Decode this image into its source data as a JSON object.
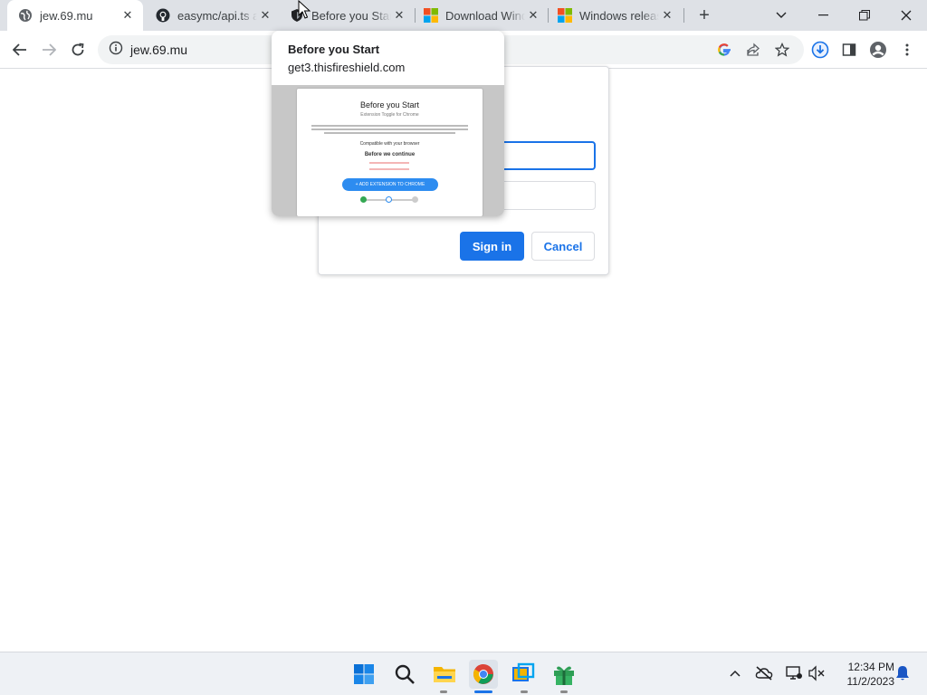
{
  "tabs": [
    {
      "title": "jew.69.mu",
      "favicon": "globe-icon",
      "active": true
    },
    {
      "title": "easymc/api.ts at",
      "favicon": "github-icon",
      "active": false
    },
    {
      "title": "Before you Start",
      "favicon": "shield-icon",
      "active": false
    },
    {
      "title": "Download Wind",
      "favicon": "microsoft-logo-icon",
      "active": false
    },
    {
      "title": "Windows releas",
      "favicon": "microsoft-logo-icon",
      "active": false
    }
  ],
  "address_bar": {
    "url": "jew.69.mu"
  },
  "auth_dialog": {
    "sign_in_label": "Sign in",
    "cancel_label": "Cancel"
  },
  "hover_card": {
    "title": "Before you Start",
    "domain": "get3.thisfireshield.com",
    "preview": {
      "heading": "Before you Start",
      "subheading": "Extension Toggle for Chrome",
      "compat_text": "Compatible with your browser",
      "continue_heading": "Before we continue",
      "cta_label": "+ ADD EXTENSION TO CHROME"
    }
  },
  "clock": {
    "time": "12:34 PM",
    "date": "11/2/2023"
  },
  "colors": {
    "accent": "#1a73e8",
    "tab_strip": "#dee1e6",
    "taskbar": "#eef1f5"
  }
}
